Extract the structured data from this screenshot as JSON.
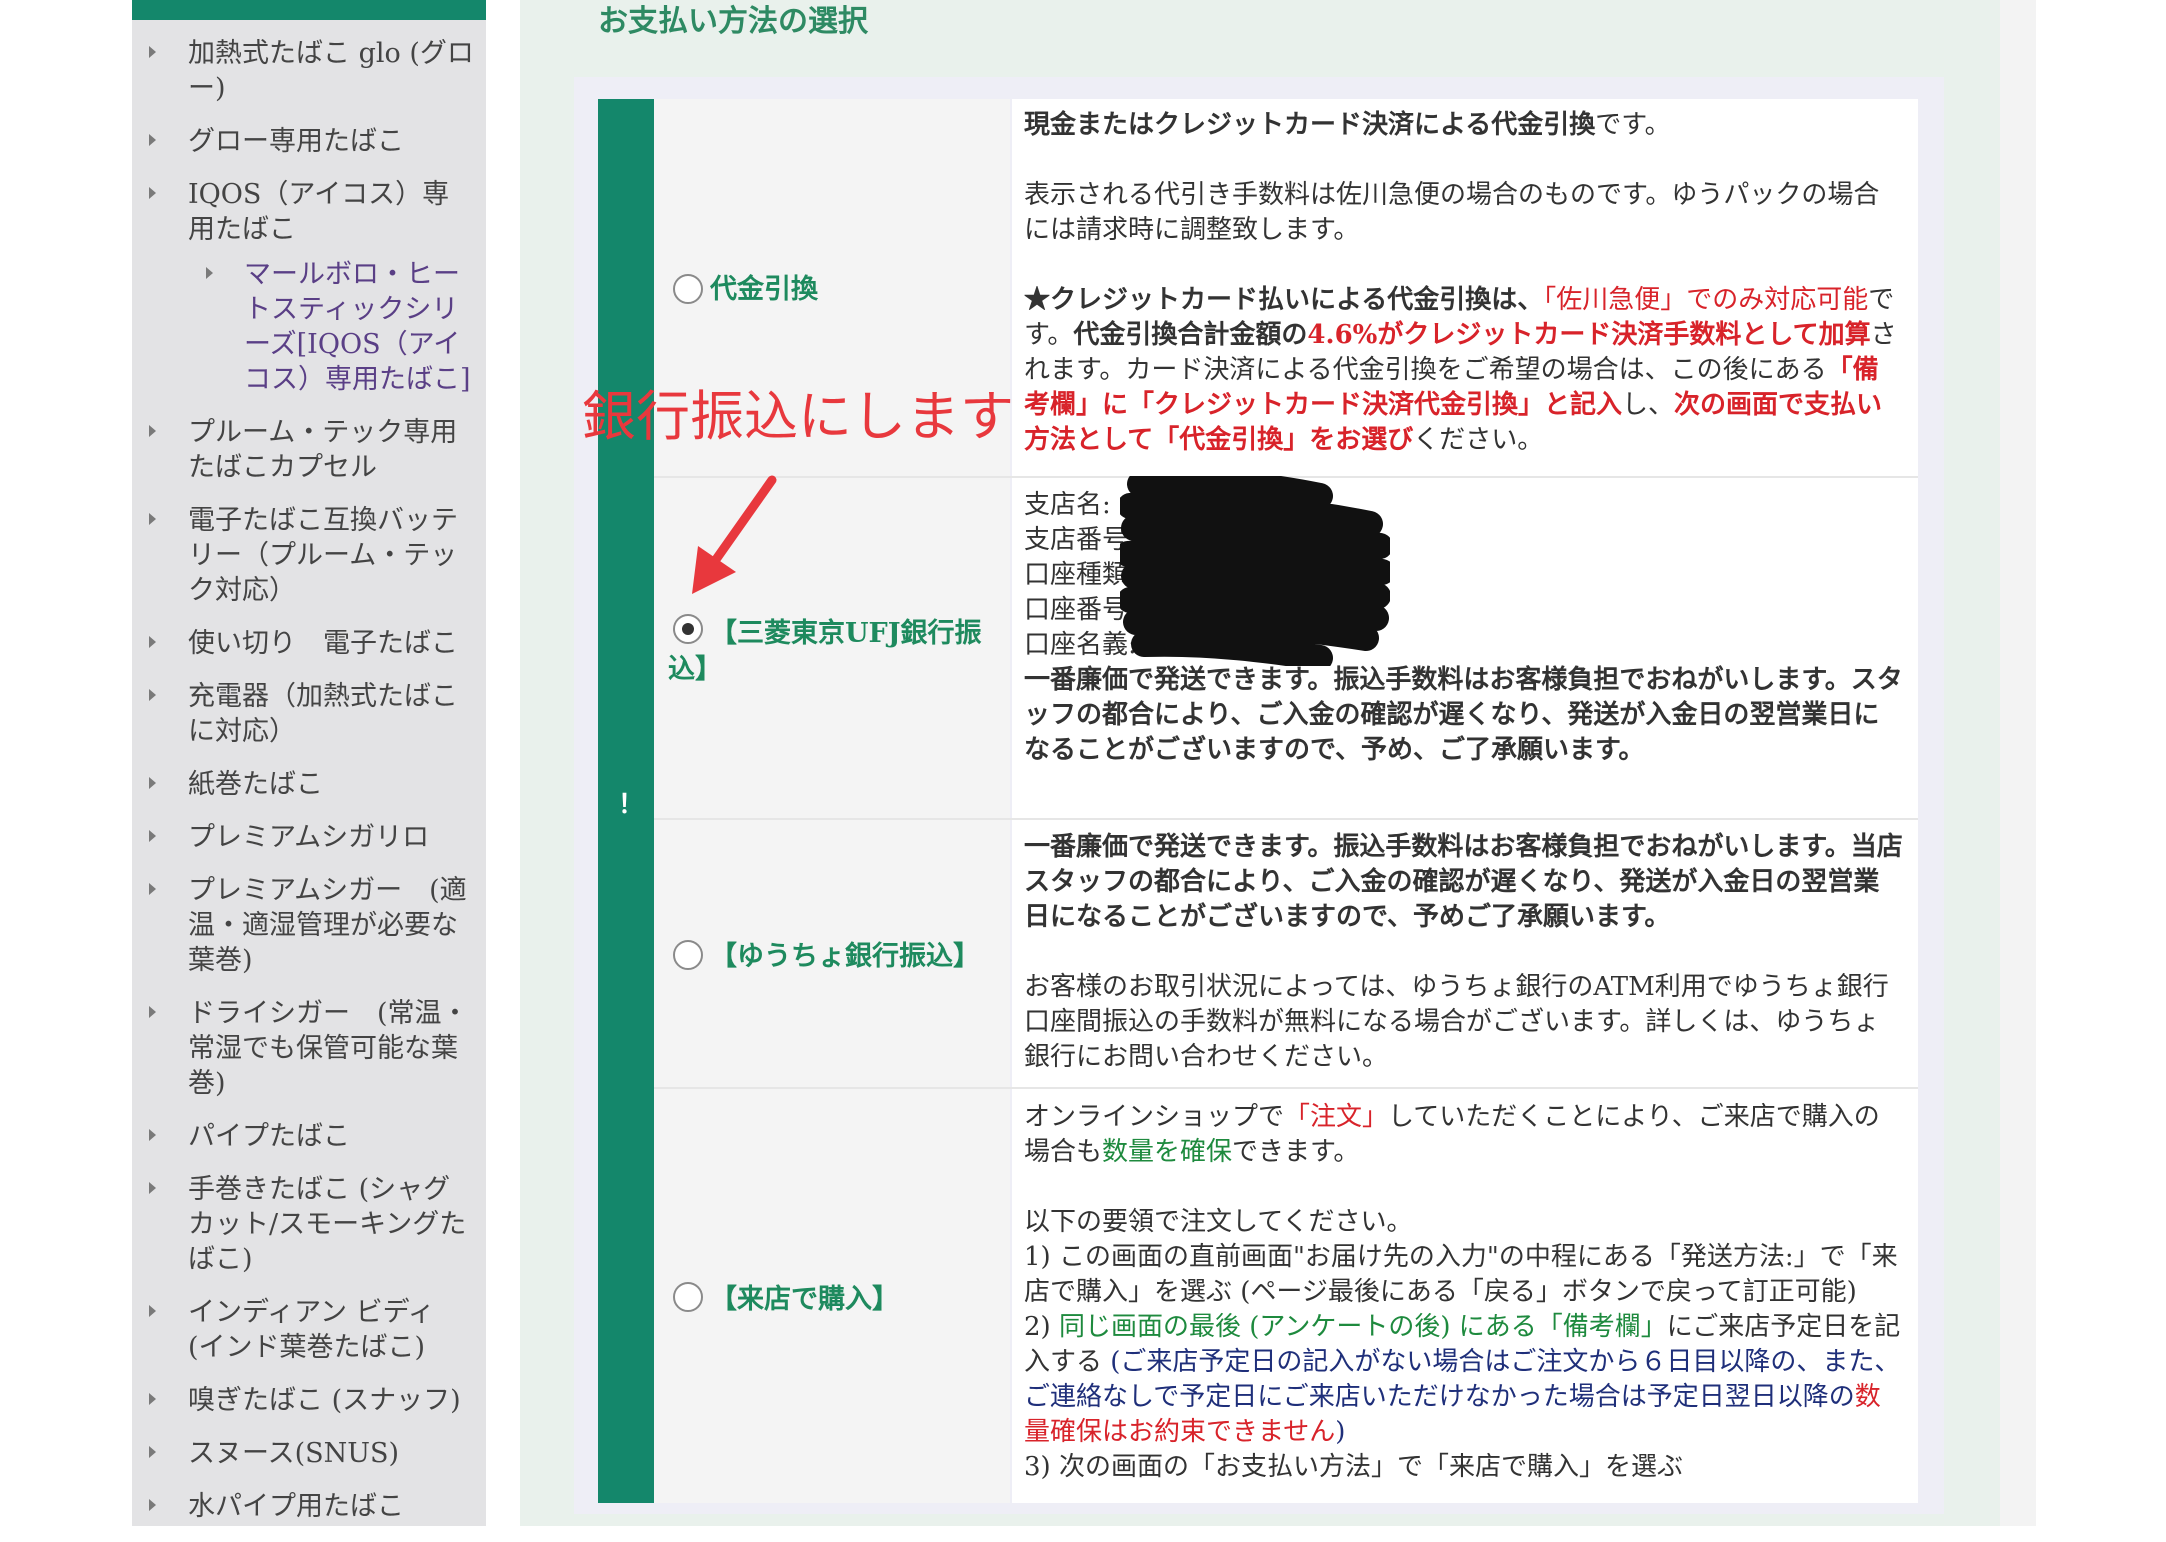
{
  "sidebar": {
    "items": [
      {
        "label": "加熱式たばこ glo (グロー)"
      },
      {
        "label": "グロー専用たばこ"
      },
      {
        "label": "IQOS（アイコス）専用たばこ"
      },
      {
        "label": "マールボロ・ヒートスティックシリーズ[IQOS（アイコス）専用たばこ]",
        "sub": true
      },
      {
        "label": "プルーム・テック専用たばこカプセル"
      },
      {
        "label": "電子たばこ互換バッテリー（プルーム・テック対応）"
      },
      {
        "label": "使い切り　電子たばこ"
      },
      {
        "label": "充電器（加熱式たばこに対応）"
      },
      {
        "label": "紙巻たばこ"
      },
      {
        "label": "プレミアムシガリロ"
      },
      {
        "label": "プレミアムシガー　(適温・適湿管理が必要な葉巻)"
      },
      {
        "label": "ドライシガー　(常温・常湿でも保管可能な葉巻)"
      },
      {
        "label": "パイプたばこ"
      },
      {
        "label": "手巻きたばこ (シャグカット/スモーキングたばこ)"
      },
      {
        "label": "インディアン ビディ (インド葉巻たばこ)"
      },
      {
        "label": "嗅ぎたばこ (スナッフ)"
      },
      {
        "label": "スヌース(SNUS)"
      },
      {
        "label": "水パイプ用たばこ"
      }
    ]
  },
  "main": {
    "title": "お支払い方法の選択",
    "side_mark": "！",
    "annotation": "銀行振込にします",
    "options": [
      {
        "label": "代金引換",
        "checked": false,
        "desc": {
          "p1_bold": "現金またはクレジットカード決済による代金引換",
          "p1_tail": "です。",
          "p2": "表示される代引き手数料は佐川急便の場合のものです。ゆうパックの場合には請求時に調整致します。",
          "p3_a": "★クレジットカード払いによる代金引換は、",
          "p3_b": "「佐川急便」でのみ対応可能",
          "p3_c": "です。",
          "p3_d": "代金引換合計金額の",
          "p3_e": "4.6%がクレジットカード決済手数料として加算",
          "p3_f": "されます。カード決済による代金引換をご希望の場合は、この後にある",
          "p3_g": "「備考欄」に「クレジットカード決済代金引換」と記入",
          "p3_h": "し、",
          "p3_i": "次の画面で支払い方法として「代金引換」をお選び",
          "p3_j": "ください。"
        }
      },
      {
        "label": "【三菱東京UFJ銀行振込】",
        "checked": true,
        "desc": {
          "field1": "支店名:",
          "field2": "支店番号:",
          "field3": "口座種類:",
          "field4": "口座番号:",
          "field5": "口座名義:",
          "note": "一番廉価で発送できます。振込手数料はお客様負担でおねがいします。スタッフの都合により、ご入金の確認が遅くなり、発送が入金日の翌営業日になることがございますので、予め、ご了承願います。"
        }
      },
      {
        "label": "【ゆうちょ銀行振込】",
        "checked": false,
        "desc": {
          "p1": "一番廉価で発送できます。振込手数料はお客様負担でおねがいします。当店スタッフの都合により、ご入金の確認が遅くなり、発送が入金日の翌営業日になることがございますので、予めご了承願います。",
          "p2": "お客様のお取引状況によっては、ゆうちょ銀行のATM利用でゆうちょ銀行口座間振込の手数料が無料になる場合がございます。詳しくは、ゆうちょ銀行にお問い合わせください。"
        }
      },
      {
        "label": "【来店で購入】",
        "checked": false,
        "desc": {
          "p1_a": "オンラインショップで",
          "p1_b": "「注文」",
          "p1_c": "していただくことにより、ご来店で購入の場合も",
          "p1_d": "数量を確保",
          "p1_e": "できます。",
          "p2": "以下の要領で注文してください。",
          "step1": "1) この画面の直前画面\"お届け先の入力\"の中程にある「発送方法:」で「来店で購入」を選ぶ (ページ最後にある「戻る」ボタンで戻って訂正可能)",
          "step2_a": "2) ",
          "step2_b": "同じ画面の最後 (アンケートの後) にある「備考欄」",
          "step2_c": "にご来店予定日を記入する",
          "step2_d": " (ご来店予定日の記入がない場合はご注文から６日目以降の、また、ご連絡なしで予定日にご来店いただけなかった場合は予定日翌日以降の",
          "step2_e": "数量確保はお約束できません",
          "step2_f": ")",
          "step3": "3) 次の画面の「お支払い方法」で「来店で購入」を選ぶ"
        }
      }
    ]
  },
  "colors": {
    "accent_green": "#14876b",
    "highlight_red": "#d8232a",
    "annotation_red": "#e8383d"
  }
}
